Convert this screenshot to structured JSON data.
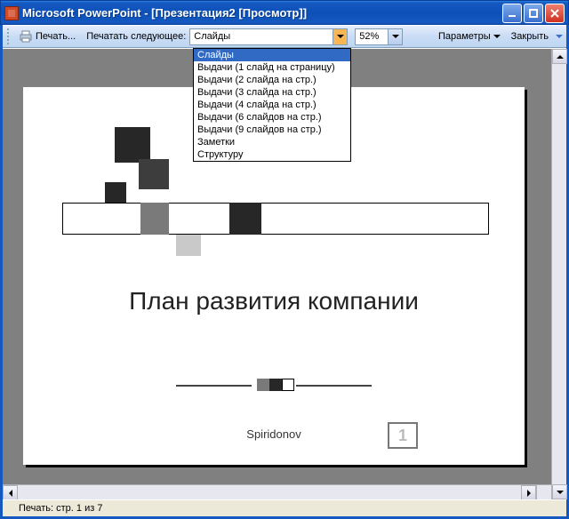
{
  "window": {
    "title": "Microsoft PowerPoint - [Презентация2 [Просмотр]]"
  },
  "toolbar": {
    "print_label": "Печать...",
    "print_what_label": "Печатать следующее:",
    "combo_value": "Слайды",
    "zoom_value": "52%",
    "options_label": "Параметры",
    "close_label": "Закрыть"
  },
  "dropdown": {
    "options": [
      "Слайды",
      "Выдачи (1 слайд на страницу)",
      "Выдачи (2 слайда на стр.)",
      "Выдачи (3 слайда на стр.)",
      "Выдачи (4 слайда на стр.)",
      "Выдачи (6 слайдов на стр.)",
      "Выдачи (9 слайдов на стр.)",
      "Заметки",
      "Структуру"
    ],
    "selected_index": 0
  },
  "slide": {
    "title": "План развития компании",
    "author": "Spiridonov",
    "page_number": "1"
  },
  "status": {
    "text": "Печать: стр. 1 из 7"
  }
}
